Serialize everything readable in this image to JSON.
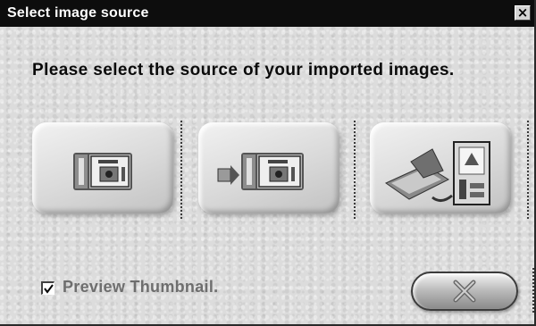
{
  "window": {
    "title": "Select image source",
    "close_glyph": "×"
  },
  "prompt": "Please select the source of your imported images.",
  "sources": [
    {
      "name": "digital-camera",
      "icon": "camera-icon"
    },
    {
      "name": "camera-transfer",
      "icon": "camera-download-icon"
    },
    {
      "name": "scanner-computer",
      "icon": "computer-scanner-icon"
    }
  ],
  "preview": {
    "label": "Preview Thumbnail.",
    "checked": true
  },
  "cancel_button": {
    "icon": "x-icon"
  },
  "colors": {
    "titlebar": "#0d0d0d",
    "panel": "#dcdcdc",
    "label_muted": "#6e6e6e"
  }
}
